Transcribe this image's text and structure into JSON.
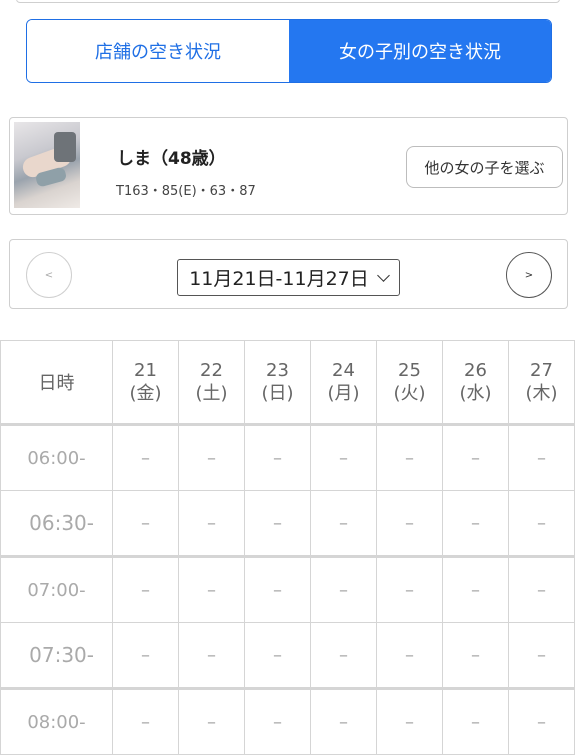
{
  "tabs": [
    {
      "label": "店舗の空き状況",
      "active": false
    },
    {
      "label": "女の子別の空き状況",
      "active": true
    }
  ],
  "girl": {
    "name": "しま（48歳）",
    "stats": "T163・85(E)・63・87",
    "choose_label": "他の女の子を選ぶ"
  },
  "date_nav": {
    "range": "11月21日-11月27日",
    "prev": "<",
    "next": ">"
  },
  "schedule": {
    "header": "日時",
    "days": [
      {
        "date": "21",
        "dow": "(金)",
        "color": "#666666"
      },
      {
        "date": "22",
        "dow": "(土)",
        "color": "#1c2f9e"
      },
      {
        "date": "23",
        "dow": "(日)",
        "color": "#c62222"
      },
      {
        "date": "24",
        "dow": "(月)",
        "color": "#c62222"
      },
      {
        "date": "25",
        "dow": "(火)",
        "color": "#666666"
      },
      {
        "date": "26",
        "dow": "(水)",
        "color": "#666666"
      },
      {
        "date": "27",
        "dow": "(木)",
        "color": "#666666"
      }
    ],
    "rows": [
      {
        "time": "06:00-",
        "cells": [
          "–",
          "–",
          "–",
          "–",
          "–",
          "–",
          "–"
        ]
      },
      {
        "time": "06:30-",
        "cells": [
          "–",
          "–",
          "–",
          "–",
          "–",
          "–",
          "–"
        ]
      },
      {
        "time": "07:00-",
        "cells": [
          "–",
          "–",
          "–",
          "–",
          "–",
          "–",
          "–"
        ]
      },
      {
        "time": "07:30-",
        "cells": [
          "–",
          "–",
          "–",
          "–",
          "–",
          "–",
          "–"
        ]
      },
      {
        "time": "08:00-",
        "cells": [
          "–",
          "–",
          "–",
          "–",
          "–",
          "–",
          "–"
        ]
      }
    ]
  }
}
